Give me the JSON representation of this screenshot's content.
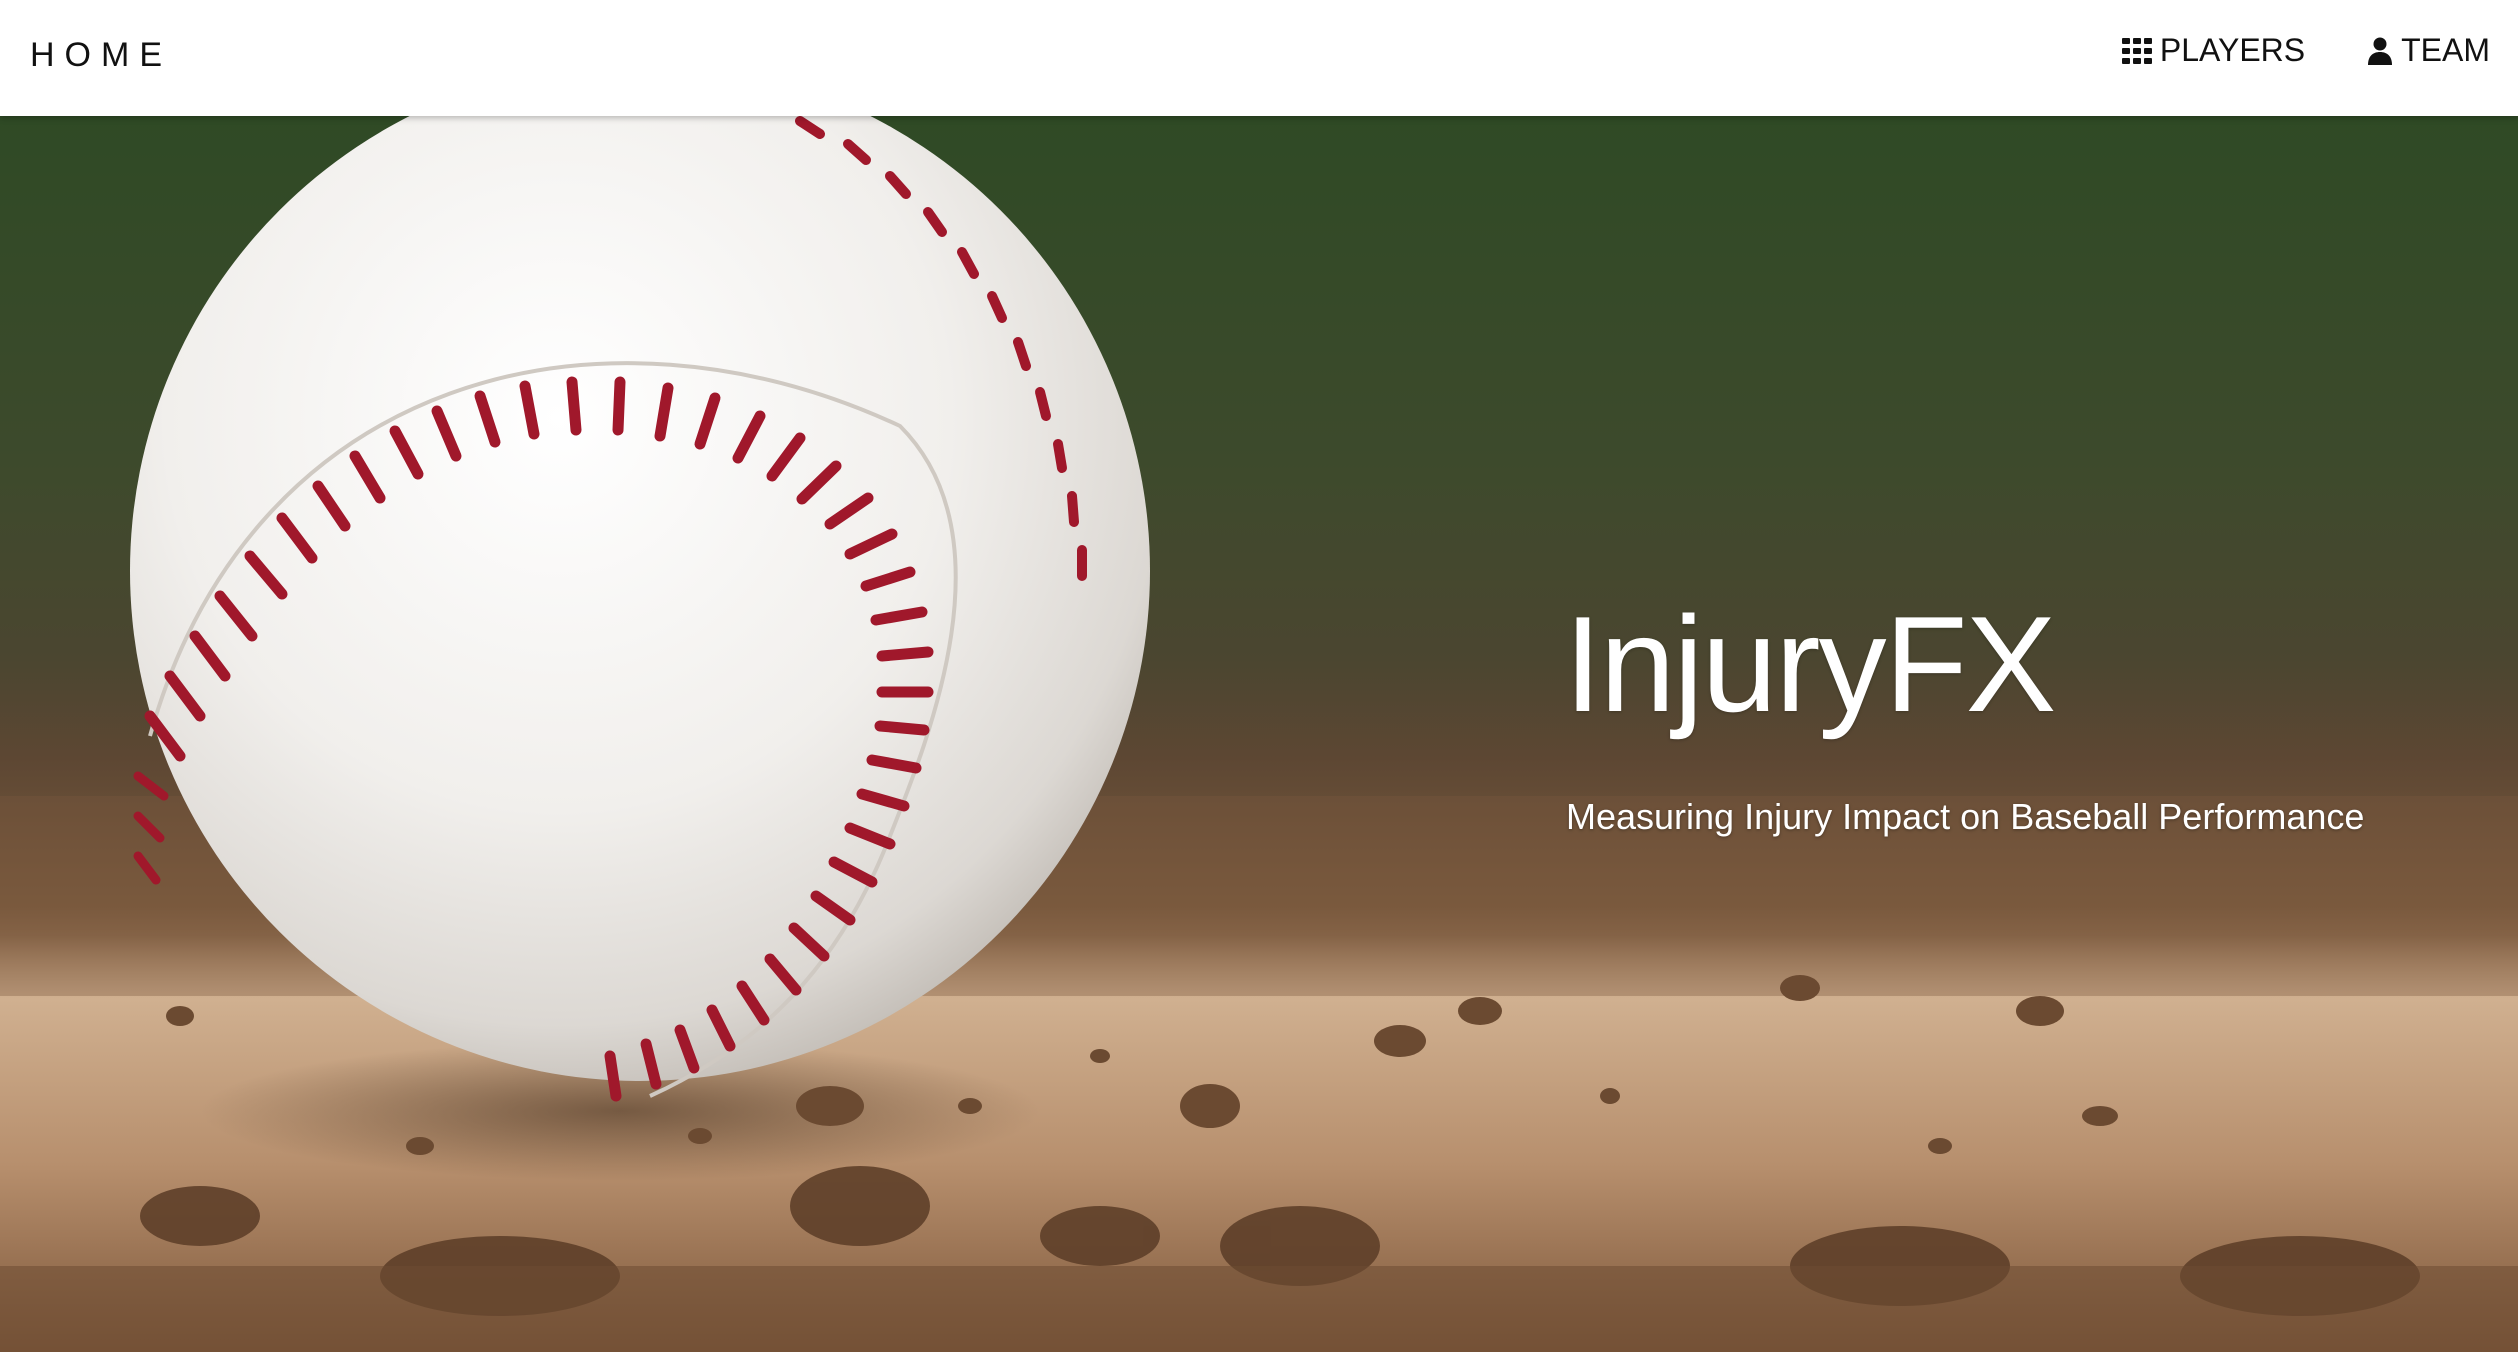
{
  "nav": {
    "brand": "HOME",
    "links": [
      {
        "label": "PLAYERS",
        "icon": "grid-icon"
      },
      {
        "label": "TEAM",
        "icon": "user-icon"
      }
    ]
  },
  "hero": {
    "title": "InjuryFX",
    "subtitle": "Measuring Injury Impact on Baseball Performance",
    "background": "baseball resting on pitcher's mound dirt",
    "colors": {
      "grass": "#3a4b2a",
      "dirt": "#b8916d",
      "ball": "#f4f2ef",
      "stitch": "#a0182b"
    }
  }
}
